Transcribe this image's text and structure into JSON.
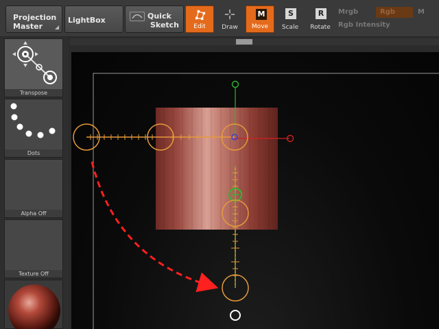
{
  "toolbar": {
    "projection_line1": "Projection",
    "projection_line2": "Master",
    "lightbox": "LightBox",
    "quick_line1": "Quick",
    "quick_line2": "Sketch",
    "modes": {
      "edit": {
        "label": "Edit",
        "active": true
      },
      "draw": {
        "label": "Draw",
        "active": false
      },
      "move": {
        "label": "Move",
        "key": "M",
        "active": true
      },
      "scale": {
        "label": "Scale",
        "key": "S",
        "active": false
      },
      "rotate": {
        "label": "Rotate",
        "key": "R",
        "active": false
      }
    },
    "mrgb": "Mrgb",
    "rgb": "Rgb",
    "m": "M",
    "rgb_intensity": "Rgb Intensity"
  },
  "shelf": {
    "transpose": "Transpose",
    "dots": "Dots",
    "alpha": "Alpha Off",
    "texture": "Texture Off"
  },
  "colors": {
    "accent": "#e46a1c",
    "cylinder": "#a9574c",
    "gizmo_orange": "#e69a3c",
    "axis_green": "#2fb82f",
    "axis_red": "#d02020",
    "arrow_red": "#ff2020"
  }
}
